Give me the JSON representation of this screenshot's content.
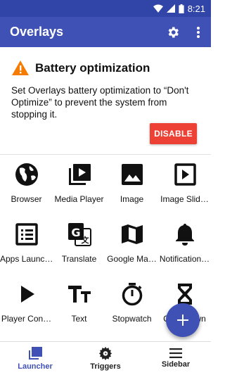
{
  "status_bar": {
    "time": "8:21"
  },
  "app_bar": {
    "title": "Overlays",
    "settings_icon": "gear-icon",
    "overflow_icon": "more-vert-icon"
  },
  "banner": {
    "title": "Battery optimization",
    "icon": "warning-icon",
    "icon_color": "#f57c00",
    "message": "Set Overlays battery optimization to “Don't Optimize” to prevent the system from stopping it.",
    "button_label": "DISABLE",
    "button_color": "#ee4136"
  },
  "launcher": {
    "items": [
      {
        "label": "Browser",
        "icon": "globe-icon"
      },
      {
        "label": "Media Player",
        "icon": "video-library-icon"
      },
      {
        "label": "Image",
        "icon": "image-icon"
      },
      {
        "label": "Image Slid…",
        "icon": "slideshow-icon"
      },
      {
        "label": "Apps Launc…",
        "icon": "list-icon"
      },
      {
        "label": "Translate",
        "icon": "translate-icon"
      },
      {
        "label": "Google Ma…",
        "icon": "map-icon"
      },
      {
        "label": "Notification…",
        "icon": "bell-icon"
      },
      {
        "label": "Player Con…",
        "icon": "play-icon"
      },
      {
        "label": "Text",
        "icon": "text-icon"
      },
      {
        "label": "Stopwatch",
        "icon": "stopwatch-icon"
      },
      {
        "label": "Countdown",
        "icon": "hourglass-icon"
      }
    ]
  },
  "fab": {
    "icon": "add-icon",
    "color": "#3f51b5"
  },
  "bottom_nav": {
    "active_color": "#3f51b5",
    "items": [
      {
        "label": "Launcher",
        "icon": "launcher-icon",
        "active": true
      },
      {
        "label": "Triggers",
        "icon": "triggers-gear-icon",
        "active": false
      },
      {
        "label": "Sidebar",
        "icon": "menu-icon",
        "active": false
      }
    ]
  }
}
